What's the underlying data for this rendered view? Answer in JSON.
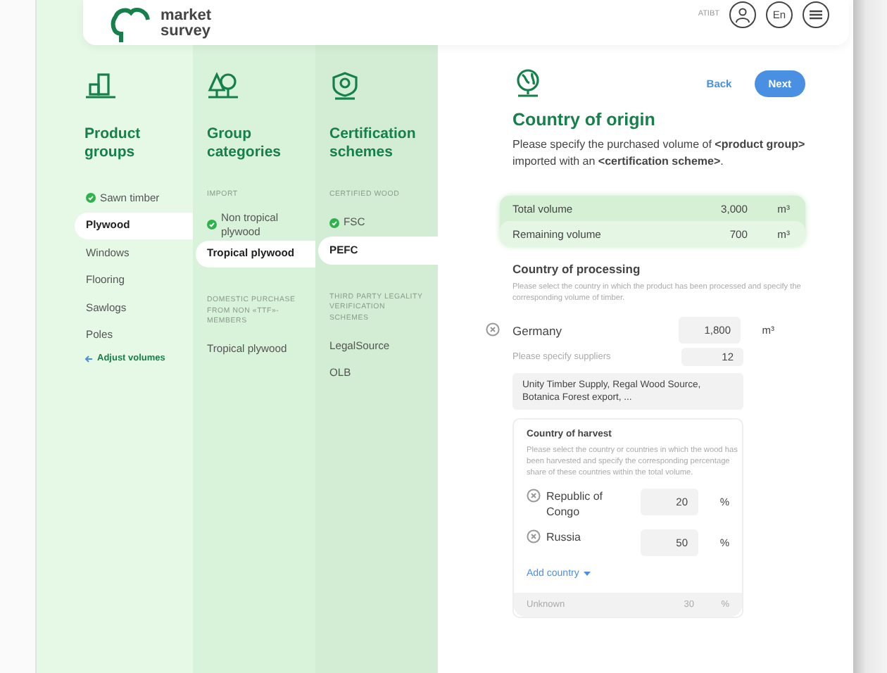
{
  "header": {
    "logo_text": "market survey",
    "organization": "ATIBT",
    "language": "En"
  },
  "columns": [
    {
      "title": "Product groups",
      "sections": [
        {
          "items": [
            {
              "label": "Sawn timber",
              "done": true,
              "selected": false
            },
            {
              "label": "Plywood",
              "done": false,
              "selected": true
            },
            {
              "label": "Windows",
              "done": false,
              "selected": false
            },
            {
              "label": "Flooring",
              "done": false,
              "selected": false
            },
            {
              "label": "Sawlogs",
              "done": false,
              "selected": false
            },
            {
              "label": "Poles",
              "done": false,
              "selected": false
            }
          ]
        }
      ],
      "link": "Adjust volumes"
    },
    {
      "title": "Group categories",
      "sections": [
        {
          "label": "IMPORT",
          "items": [
            {
              "label": "Non tropical plywood",
              "done": true,
              "selected": false
            },
            {
              "label": "Tropical plywood",
              "done": false,
              "selected": true
            }
          ]
        },
        {
          "label": "DOMESTIC PURCHASE FROM NON «TTF»-MEMBERS",
          "items": [
            {
              "label": "Tropical plywood",
              "done": false,
              "selected": false
            }
          ]
        }
      ]
    },
    {
      "title": "Certification schemes",
      "sections": [
        {
          "label": "CERTIFIED WOOD",
          "items": [
            {
              "label": "FSC",
              "done": true,
              "selected": false
            },
            {
              "label": "PEFC",
              "done": false,
              "selected": true
            }
          ]
        },
        {
          "label": "THIRD PARTY LEGALITY VERIFICATION SCHEMES",
          "items": [
            {
              "label": "LegalSource",
              "done": false,
              "selected": false
            },
            {
              "label": "OLB",
              "done": false,
              "selected": false
            }
          ]
        }
      ]
    }
  ],
  "main": {
    "back": "Back",
    "next": "Next",
    "title": "Country of origin",
    "description": "Please specify the purchased volume of **<product group>** imported with an **<certification scheme>**.",
    "volumes": [
      {
        "label": "Total volume",
        "value": "3,000",
        "unit": "m³",
        "highlighted": false
      },
      {
        "label": "Remaining volume",
        "value": "700",
        "unit": "m³",
        "highlighted": true
      }
    ],
    "processing": {
      "title": "Country of processing",
      "hint": "Please select the country in which the product has been processed and specify the corresponding volume of timber.",
      "countries": [
        {
          "name": "Germany",
          "value": "1,800",
          "unit": "m³",
          "suppliers_label": "Please specify suppliers",
          "suppliers_count": "12",
          "suppliers": "Unity Timber Supply, Regal Wood Source, Botanica Forest export, ..."
        }
      ]
    },
    "harvest": {
      "title": "Country of harvest",
      "hint": "Please select the country or countries in which the wood has been harvested and specify the corresponding percentage share of these countries within the total volume.",
      "countries": [
        {
          "name": "Republic of Congo",
          "value": "20",
          "unit": "%"
        },
        {
          "name": "Russia",
          "value": "50",
          "unit": "%"
        }
      ],
      "add": "Add country",
      "unknown": {
        "label": "Unknown",
        "value": "30",
        "unit": "%"
      }
    }
  }
}
